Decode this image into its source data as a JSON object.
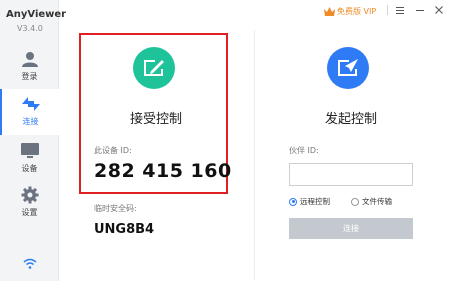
{
  "app": {
    "name": "AnyViewer",
    "version": "V3.4.0"
  },
  "titlebar": {
    "vip_label": "免费版 VIP",
    "vip_color": "#f08a24"
  },
  "sidebar": {
    "items": [
      {
        "label": "登录",
        "icon": "user-icon",
        "active": false
      },
      {
        "label": "连接",
        "icon": "connect-icon",
        "active": true
      },
      {
        "label": "设备",
        "icon": "monitor-icon",
        "active": false
      },
      {
        "label": "设置",
        "icon": "gear-icon",
        "active": false
      }
    ],
    "accent_color": "#2f7bf5"
  },
  "receive": {
    "title": "接受控制",
    "device_id_label": "此设备 ID:",
    "device_id": "282 415 160",
    "temp_code_label": "临时安全码:",
    "temp_code": "UNG8B4",
    "icon_color": "#1fc39a"
  },
  "initiate": {
    "title": "发起控制",
    "partner_id_label": "伙伴 ID:",
    "partner_id_value": "",
    "options": [
      {
        "label": "远程控制",
        "selected": true
      },
      {
        "label": "文件传输",
        "selected": false
      }
    ],
    "connect_label": "连接",
    "icon_color": "#2f7bf5"
  }
}
